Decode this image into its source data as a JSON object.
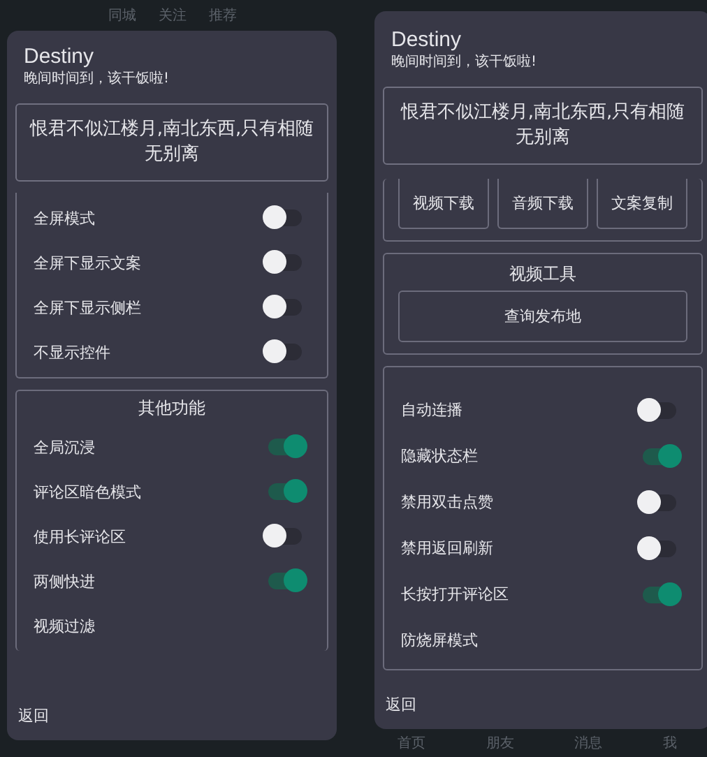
{
  "phones": [
    {
      "top_bar": [
        "同城",
        "关注",
        "推荐"
      ],
      "dialog": {
        "title": "Destiny",
        "subtitle": "晚间时间到，该干饭啦!",
        "quote": "恨君不似江楼月,南北东西,只有相随无别离",
        "sections": [
          {
            "kind": "toggles",
            "rows": [
              {
                "kind": "toggle",
                "label": "全屏模式",
                "on": false
              },
              {
                "kind": "toggle",
                "label": "全屏下显示文案",
                "on": false
              },
              {
                "kind": "toggle",
                "label": "全屏下显示侧栏",
                "on": false
              },
              {
                "kind": "toggle",
                "label": "不显示控件",
                "on": false
              }
            ]
          },
          {
            "kind": "toggles",
            "title": "其他功能",
            "rows": [
              {
                "kind": "toggle",
                "label": "全局沉浸",
                "on": true
              },
              {
                "kind": "toggle",
                "label": "评论区暗色模式",
                "on": true
              },
              {
                "kind": "toggle",
                "label": "使用长评论区",
                "on": false
              },
              {
                "kind": "toggle",
                "label": "两侧快进",
                "on": true
              },
              {
                "kind": "link",
                "label": "视频过滤"
              }
            ]
          }
        ],
        "back": "返回"
      }
    },
    {
      "bottom_nav": [
        "首页",
        "朋友",
        "消息",
        "我"
      ],
      "dialog": {
        "title": "Destiny",
        "subtitle": "晚间时间到，该干饭啦!",
        "quote": "恨君不似江楼月,南北东西,只有相随无别离",
        "sections": [
          {
            "kind": "buttons",
            "buttons": [
              "视频下载",
              "音频下载",
              "文案复制"
            ]
          },
          {
            "kind": "tool",
            "title": "视频工具",
            "buttons": [
              "查询发布地"
            ]
          },
          {
            "kind": "toggles",
            "rows": [
              {
                "kind": "toggle",
                "label": "自动连播",
                "on": false
              },
              {
                "kind": "toggle",
                "label": "隐藏状态栏",
                "on": true
              },
              {
                "kind": "toggle",
                "label": "禁用双击点赞",
                "on": false
              },
              {
                "kind": "toggle",
                "label": "禁用返回刷新",
                "on": false
              },
              {
                "kind": "toggle",
                "label": "长按打开评论区",
                "on": true
              },
              {
                "kind": "link",
                "label": "防烧屏模式"
              }
            ]
          }
        ],
        "back": "返回"
      }
    }
  ]
}
